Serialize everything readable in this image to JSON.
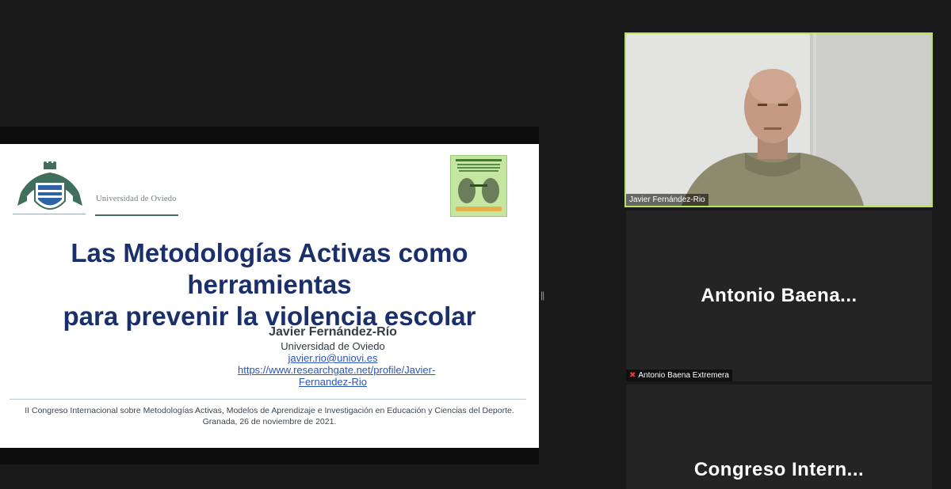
{
  "slide": {
    "university_label": "Universidad de Oviedo",
    "title_line1": "Las Metodologías Activas como herramientas",
    "title_line2": "para prevenir la violencia escolar",
    "author_name": "Javier Fernández-Río",
    "affiliation": "Universidad de Oviedo",
    "email": "javier.rio@uniovi.es",
    "url": "https://www.researchgate.net/profile/Javier-Fernandez-Rio",
    "footer_line1": "II Congreso Internacional sobre Metodologías Activas, Modelos de Aprendizaje e Investigación en Educación y Ciencias del Deporte.",
    "footer_line2": "Granada, 26 de noviembre de 2021.",
    "title_color": "#1b2f6b",
    "link_color": "#2a55b8"
  },
  "participants": {
    "speaker": {
      "name": "Javier Fernández-Rio",
      "active_border_color": "#b9e35a"
    },
    "antonio": {
      "display_name": "Antonio  Baena...",
      "label": "Antonio Baena Extremera",
      "muted": true
    },
    "congreso": {
      "display_name": "Congreso  Intern..."
    }
  }
}
